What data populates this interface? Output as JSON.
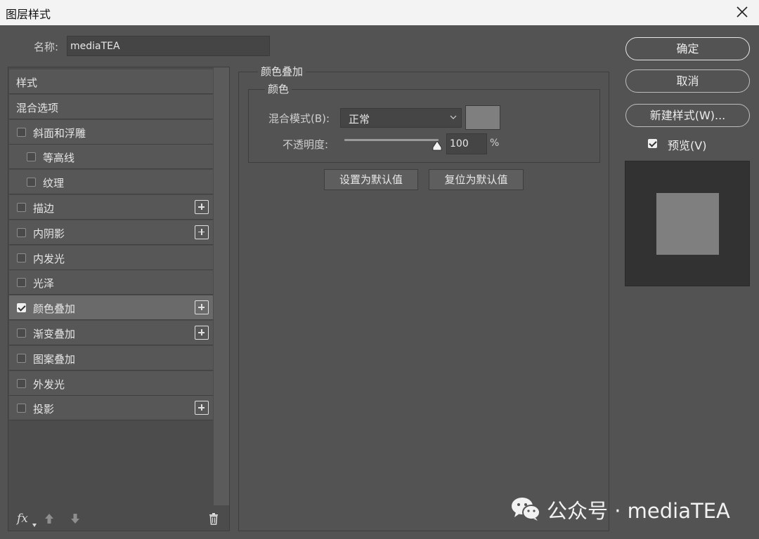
{
  "window": {
    "title": "图层样式"
  },
  "name": {
    "label": "名称:",
    "value": "mediaTEA"
  },
  "styles_list": {
    "items": [
      {
        "label": "样式",
        "has_checkbox": false,
        "checked": false,
        "indent": 0,
        "has_add": false,
        "selected": false
      },
      {
        "label": "混合选项",
        "has_checkbox": false,
        "checked": false,
        "indent": 0,
        "has_add": false,
        "selected": false
      },
      {
        "label": "斜面和浮雕",
        "has_checkbox": true,
        "checked": false,
        "indent": 0,
        "has_add": false,
        "selected": false
      },
      {
        "label": "等高线",
        "has_checkbox": true,
        "checked": false,
        "indent": 1,
        "has_add": false,
        "selected": false
      },
      {
        "label": "纹理",
        "has_checkbox": true,
        "checked": false,
        "indent": 1,
        "has_add": false,
        "selected": false
      },
      {
        "label": "描边",
        "has_checkbox": true,
        "checked": false,
        "indent": 0,
        "has_add": true,
        "selected": false
      },
      {
        "label": "内阴影",
        "has_checkbox": true,
        "checked": false,
        "indent": 0,
        "has_add": true,
        "selected": false
      },
      {
        "label": "内发光",
        "has_checkbox": true,
        "checked": false,
        "indent": 0,
        "has_add": false,
        "selected": false
      },
      {
        "label": "光泽",
        "has_checkbox": true,
        "checked": false,
        "indent": 0,
        "has_add": false,
        "selected": false
      },
      {
        "label": "颜色叠加",
        "has_checkbox": true,
        "checked": true,
        "indent": 0,
        "has_add": true,
        "selected": true
      },
      {
        "label": "渐变叠加",
        "has_checkbox": true,
        "checked": false,
        "indent": 0,
        "has_add": true,
        "selected": false
      },
      {
        "label": "图案叠加",
        "has_checkbox": true,
        "checked": false,
        "indent": 0,
        "has_add": false,
        "selected": false
      },
      {
        "label": "外发光",
        "has_checkbox": true,
        "checked": false,
        "indent": 0,
        "has_add": false,
        "selected": false
      },
      {
        "label": "投影",
        "has_checkbox": true,
        "checked": false,
        "indent": 0,
        "has_add": true,
        "selected": false
      }
    ],
    "bottom": {
      "fx_label": "fx"
    }
  },
  "color_overlay": {
    "group_title": "颜色叠加",
    "color_group_title": "颜色",
    "blend_mode_label": "混合模式(B):",
    "blend_mode_value": "正常",
    "overlay_color": "#7f7f7f",
    "opacity_label": "不透明度:",
    "opacity_value": "100",
    "opacity_unit": "%",
    "opacity_fraction": 1.0,
    "set_default_label": "设置为默认值",
    "reset_default_label": "复位为默认值"
  },
  "actions": {
    "ok_label": "确定",
    "cancel_label": "取消",
    "new_style_label": "新建样式(W)...",
    "preview_label": "预览(V)",
    "preview_checked": true
  },
  "watermark": {
    "text": "公众号 · mediaTEA"
  }
}
